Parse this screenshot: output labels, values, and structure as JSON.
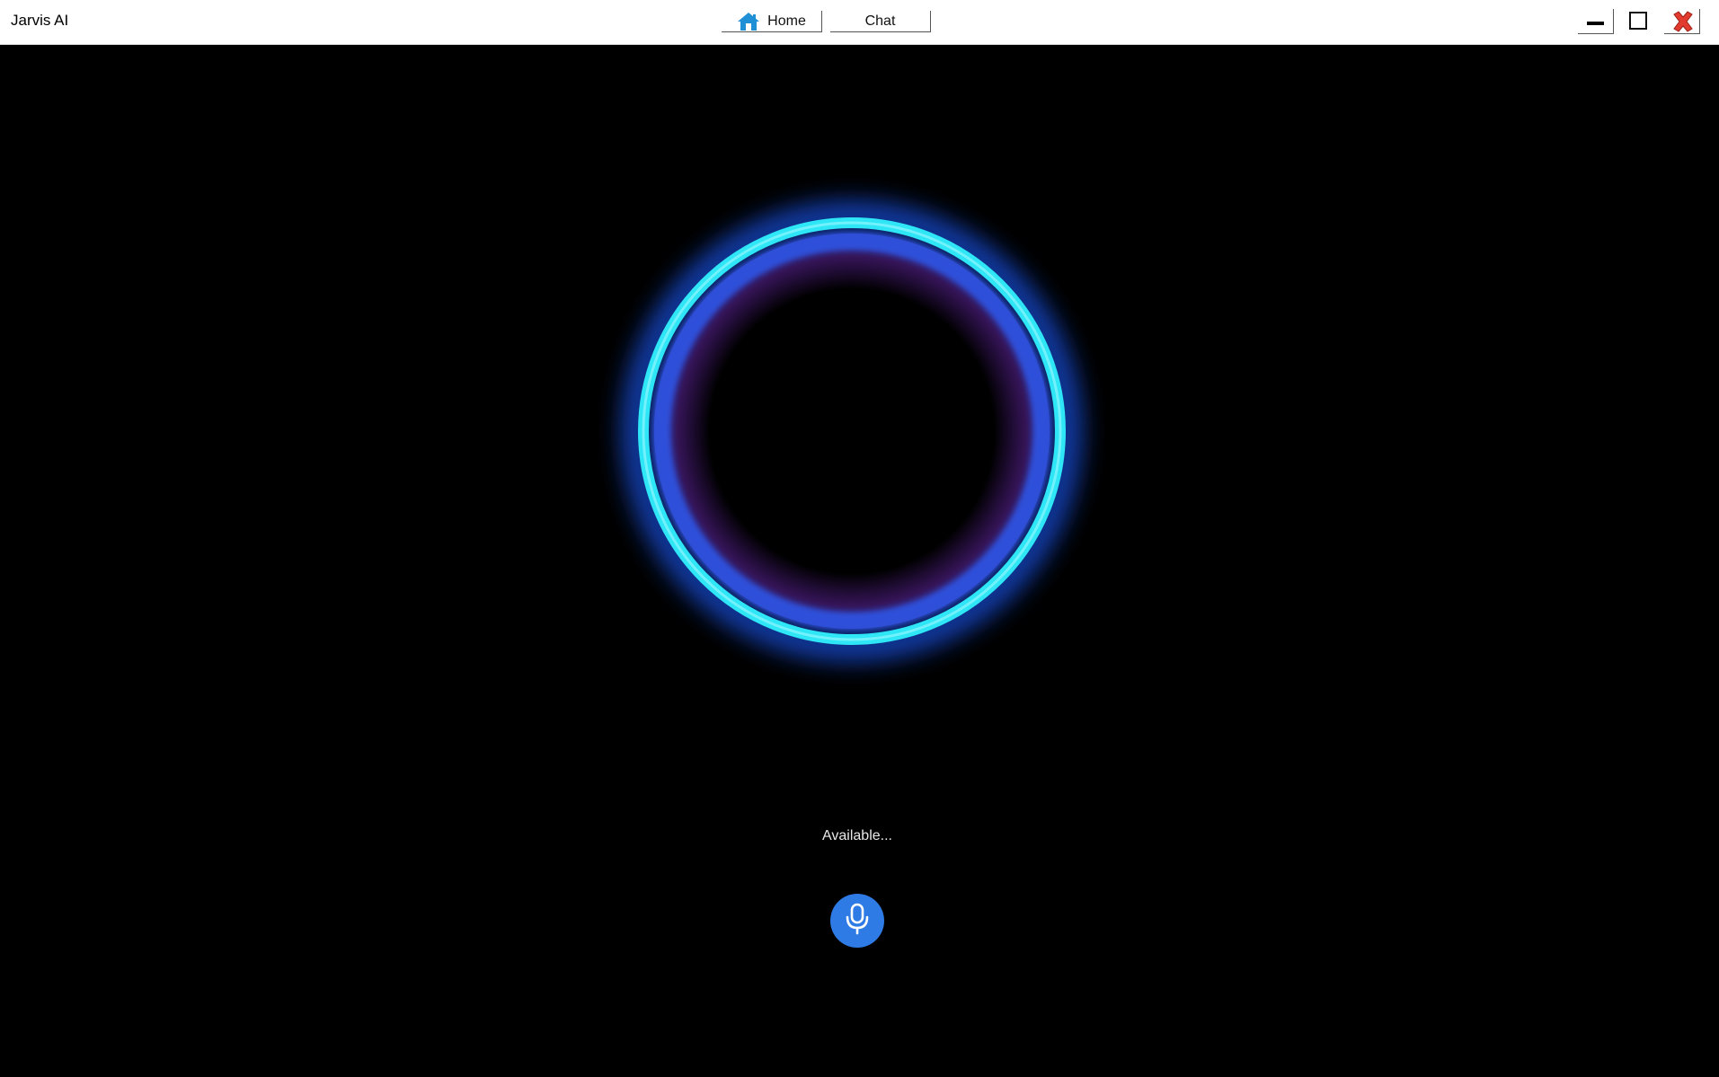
{
  "window": {
    "title": "Jarvis AI"
  },
  "nav": {
    "home_label": "Home",
    "chat_label": "Chat",
    "home_icon": "home-icon"
  },
  "window_controls": {
    "minimize_icon": "minimize-icon",
    "maximize_icon": "maximize-icon",
    "close_icon": "close-icon"
  },
  "main": {
    "status_text": "Available...",
    "mic_icon": "microphone-icon"
  },
  "colors": {
    "ring_cyan": "#2ee6f5",
    "ring_blue": "#2f4fd9",
    "ring_glow": "#1a5cff",
    "inner_purple": "#3a1660",
    "mic_button": "#2f7be6",
    "close_red": "#e23a2e"
  }
}
